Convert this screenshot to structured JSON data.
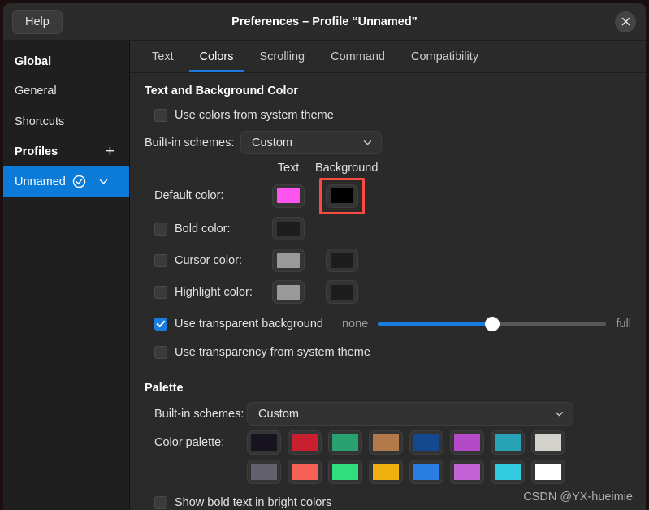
{
  "window": {
    "title": "Preferences – Profile “Unnamed”",
    "help_label": "Help",
    "close_icon": "close-icon"
  },
  "sidebar": {
    "global_header": "Global",
    "items": [
      {
        "label": "General"
      },
      {
        "label": "Shortcuts"
      }
    ],
    "profiles_header": "Profiles",
    "add_icon": "+",
    "profiles": [
      {
        "label": "Unnamed",
        "selected": true,
        "check_icon": "check-circle-icon",
        "menu_icon": "chevron-down-icon"
      }
    ]
  },
  "tabs": [
    {
      "label": "Text",
      "active": false
    },
    {
      "label": "Colors",
      "active": true
    },
    {
      "label": "Scrolling",
      "active": false
    },
    {
      "label": "Command",
      "active": false
    },
    {
      "label": "Compatibility",
      "active": false
    }
  ],
  "text_bg_section": {
    "title": "Text and Background Color",
    "use_system_theme": {
      "label": "Use colors from system theme",
      "checked": false
    },
    "builtin_schemes_label": "Built-in schemes:",
    "builtin_schemes_value": "Custom",
    "col_text": "Text",
    "col_background": "Background",
    "rows": [
      {
        "label": "Default color:",
        "has_checkbox": false,
        "checked": false,
        "text_color": "#ff55ee",
        "bg_color": "#000000",
        "has_bg": true,
        "highlighted": true
      },
      {
        "label": "Bold color:",
        "has_checkbox": true,
        "checked": false,
        "text_color": "#1d1d1d",
        "bg_color": null,
        "has_bg": false,
        "highlighted": false
      },
      {
        "label": "Cursor color:",
        "has_checkbox": true,
        "checked": false,
        "text_color": "#9a9a9a",
        "bg_color": "#1d1d1d",
        "has_bg": true,
        "highlighted": false
      },
      {
        "label": "Highlight color:",
        "has_checkbox": true,
        "checked": false,
        "text_color": "#9a9a9a",
        "bg_color": "#1d1d1d",
        "has_bg": true,
        "highlighted": false
      }
    ],
    "transparent_bg": {
      "label": "Use transparent background",
      "checked": true
    },
    "slider": {
      "min_label": "none",
      "max_label": "full",
      "value_percent": 50
    },
    "transparency_system": {
      "label": "Use transparency from system theme",
      "checked": false
    }
  },
  "palette_section": {
    "title": "Palette",
    "builtin_schemes_label": "Built-in schemes:",
    "builtin_schemes_value": "Custom",
    "color_palette_label": "Color palette:",
    "row1": [
      "#17131f",
      "#c8202f",
      "#27a270",
      "#b2794b",
      "#14498f",
      "#b44ac7",
      "#27a3b5",
      "#d4d2cd"
    ],
    "row2": [
      "#63616e",
      "#f76054",
      "#31dd7e",
      "#efb010",
      "#2a7de1",
      "#c462d6",
      "#32cade",
      "#ffffff"
    ],
    "show_bold_bright": {
      "label": "Show bold text in bright colors",
      "checked": false
    }
  },
  "watermark": "CSDN @YX-hueimie",
  "colors": {
    "accent": "#1b7ce0",
    "selection": "#0c7bd8",
    "highlight_box": "#fa4a42"
  }
}
